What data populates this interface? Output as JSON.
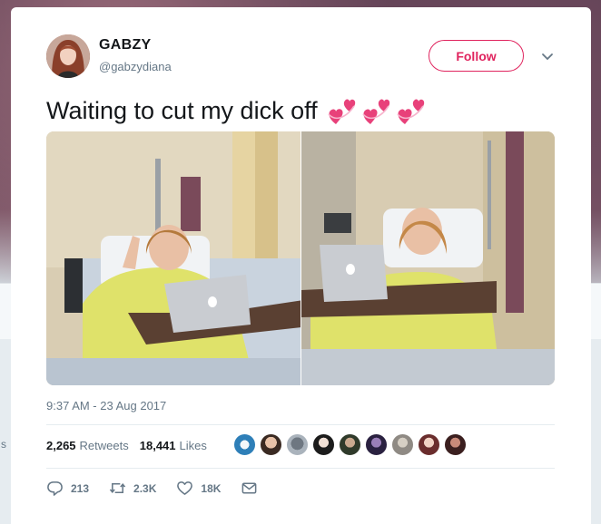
{
  "tweet": {
    "author": {
      "name": "GABZY",
      "handle": "@gabzydiana"
    },
    "follow_label": "Follow",
    "text": "Waiting to cut my dick off",
    "emoji": [
      "two-hearts-icon",
      "two-hearts-icon",
      "two-hearts-icon"
    ],
    "timestamp": "9:37 AM - 23 Aug 2017",
    "retweets_count": "2,265",
    "retweets_label": "Retweets",
    "likes_count": "18,441",
    "likes_label": "Likes",
    "liker_count": 9,
    "actions": {
      "replies": "213",
      "retweets": "2.3K",
      "likes": "18K"
    }
  },
  "backdrop": {
    "edge_text": "s"
  },
  "colors": {
    "accent": "#e0245e",
    "text_primary": "#14171a",
    "text_secondary": "#657786",
    "divider": "#e6ecf0"
  }
}
